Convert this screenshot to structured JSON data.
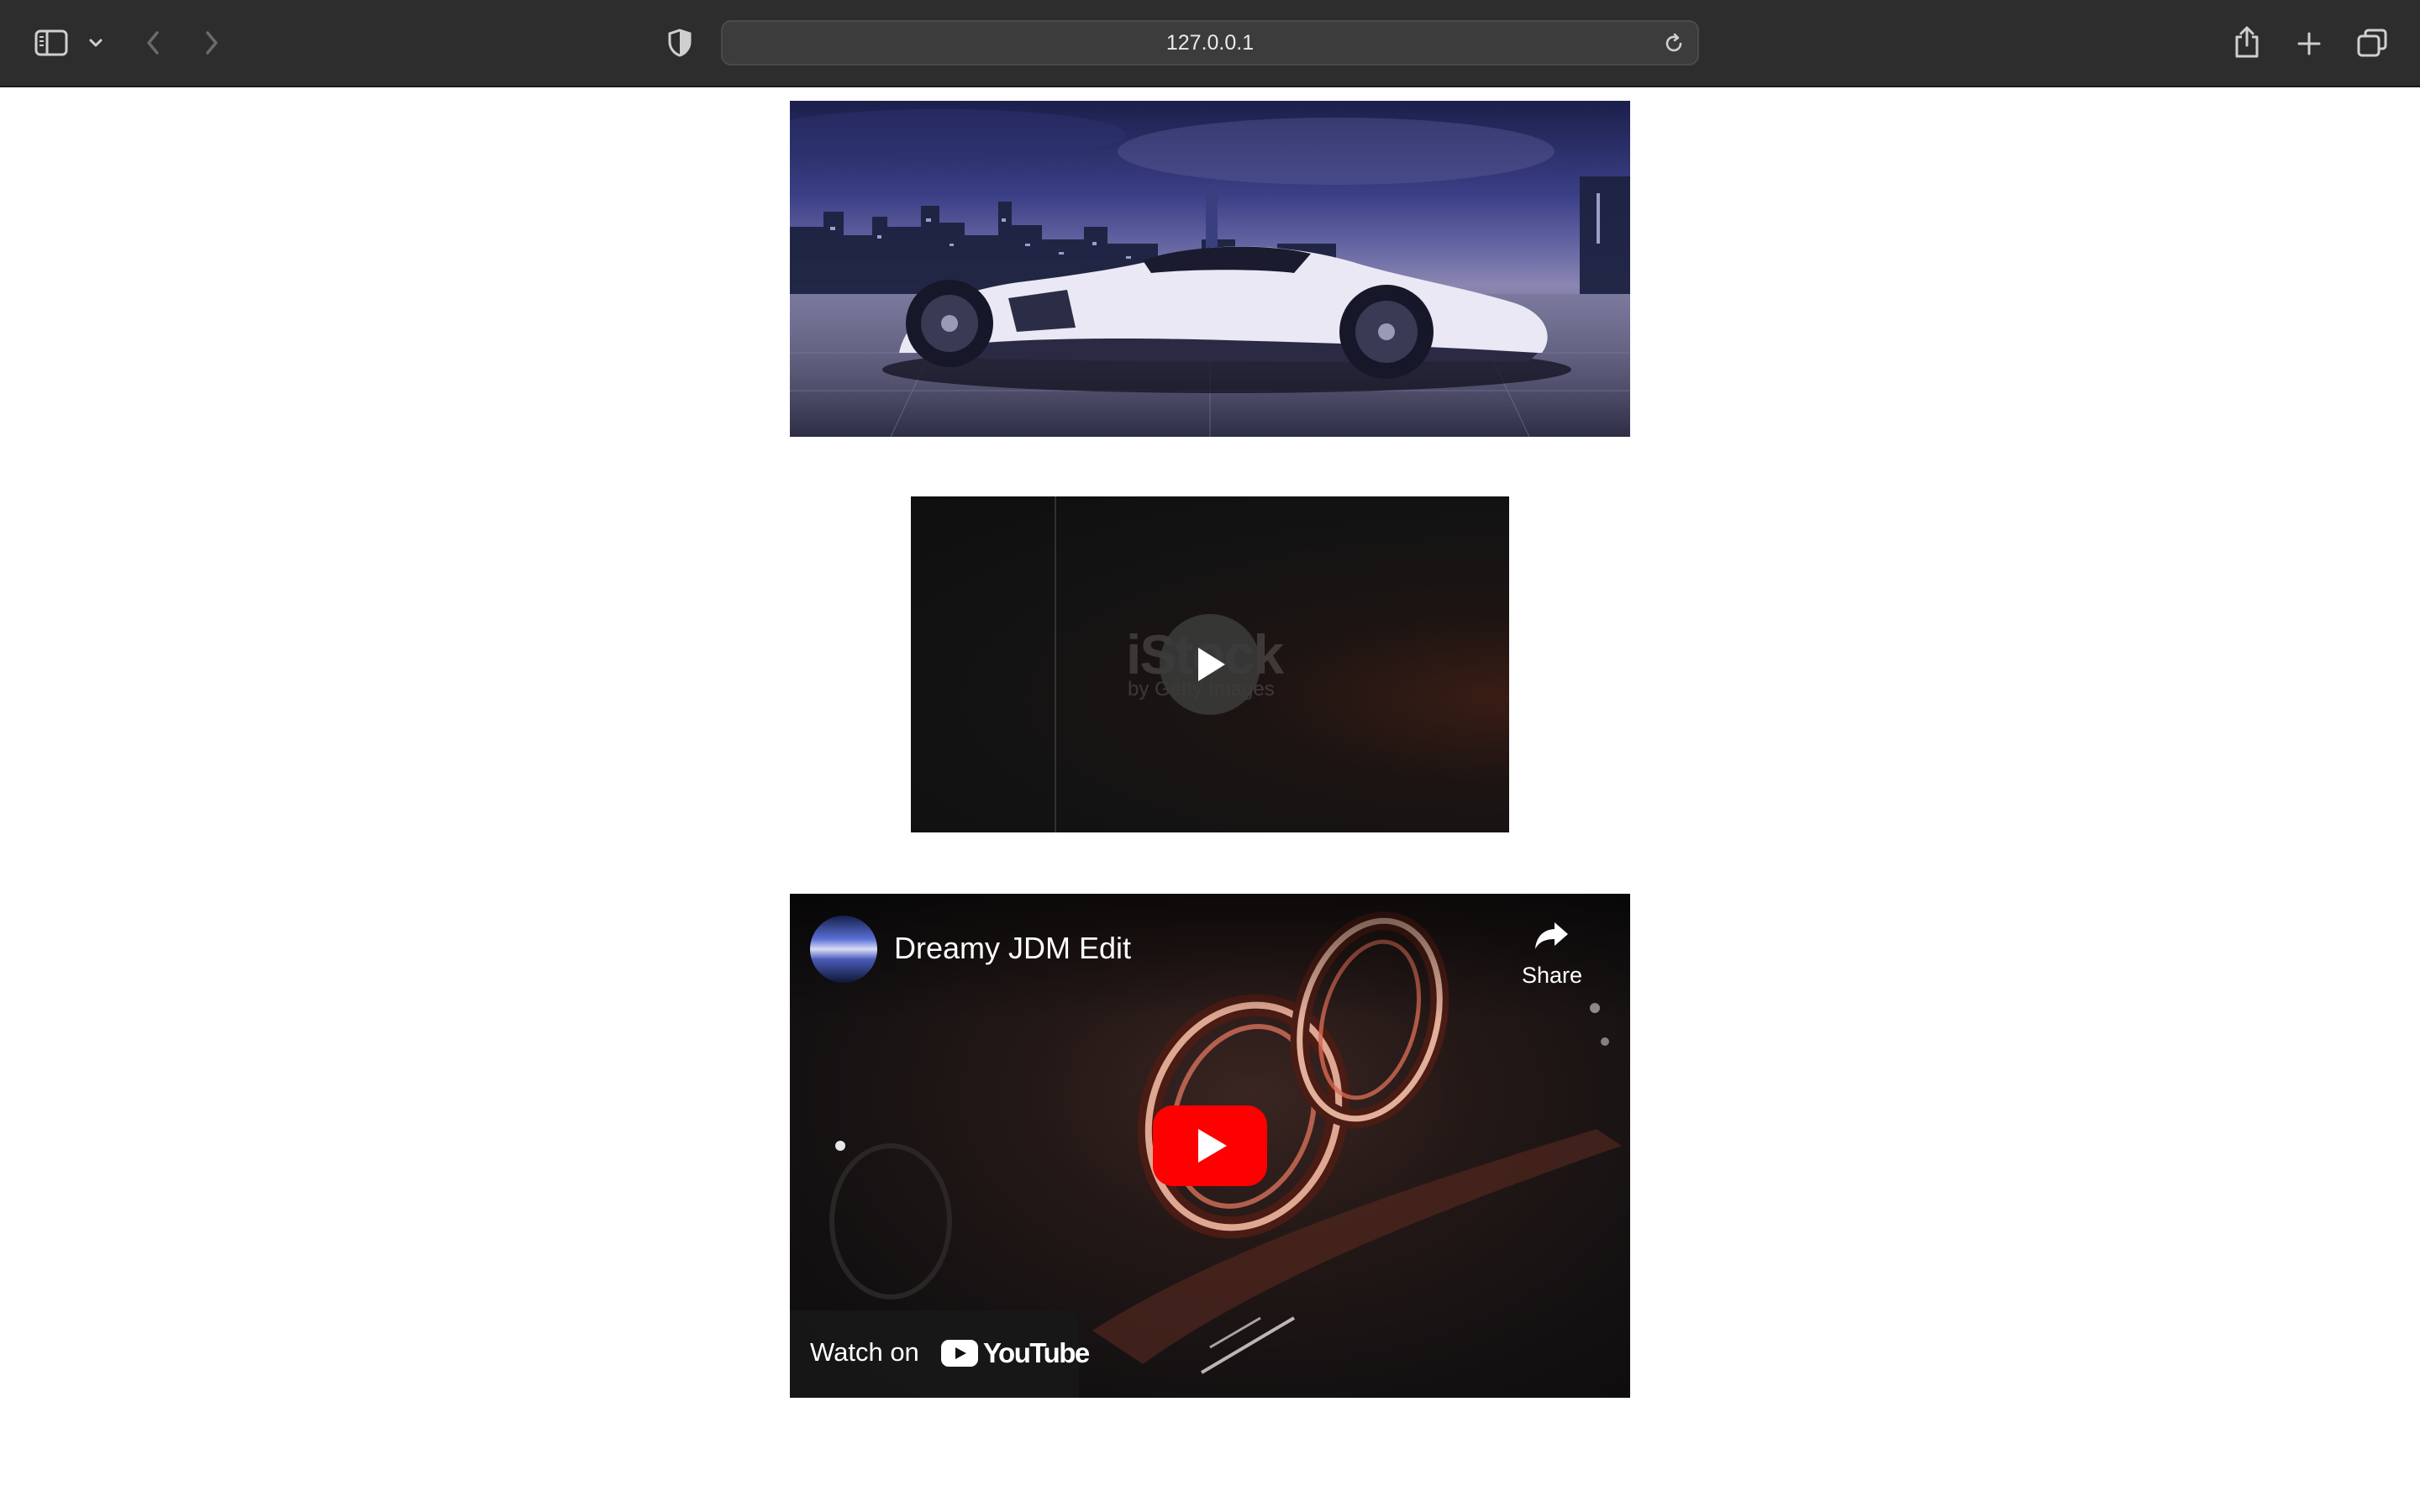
{
  "browser": {
    "url": "127.0.0.1",
    "icons": {
      "sidebar": "sidebar-icon",
      "sidebar_menu": "chevron-down-icon",
      "back": "back-arrow-icon",
      "forward": "forward-arrow-icon",
      "privacy": "shield-icon",
      "reload": "reload-icon",
      "share": "share-icon",
      "new_tab": "plus-icon",
      "tabs": "tab-overview-icon"
    }
  },
  "stock_video": {
    "watermark": "iStock",
    "watermark_sub": "by Getty Images"
  },
  "youtube": {
    "title": "Dreamy JDM Edit",
    "share_label": "Share",
    "watch_on_label": "Watch on",
    "logo_text": "YouTube",
    "brand_color": "#ff0000"
  }
}
